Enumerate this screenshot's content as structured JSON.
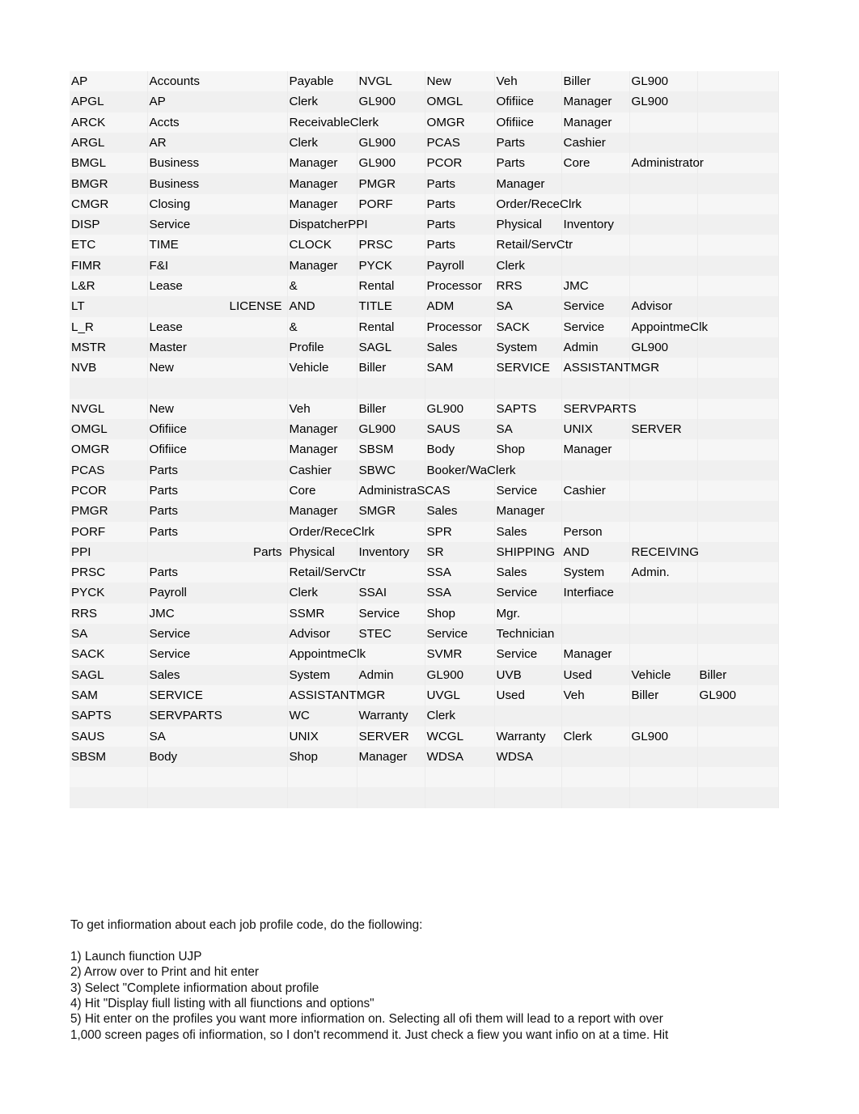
{
  "document": {
    "kind": "job-profile-code-listing",
    "columns": 9
  },
  "table": {
    "rows": [
      {
        "cells": [
          "AP",
          "Accounts",
          "Payable",
          "NVGL",
          "New",
          "Veh",
          "Biller",
          "GL900",
          ""
        ],
        "align2": "left"
      },
      {
        "cells": [
          "APGL",
          "AP",
          "Clerk",
          "GL900",
          "OMGL",
          "Ofifiice",
          "Manager",
          "GL900",
          ""
        ],
        "align2": "left"
      },
      {
        "cells": [
          "ARCK",
          "Accts",
          "ReceivableClerk",
          "",
          "OMGR",
          "Ofifiice",
          "Manager",
          "",
          ""
        ],
        "align2": "left"
      },
      {
        "cells": [
          "ARGL",
          "AR",
          "Clerk",
          "GL900",
          "PCAS",
          "Parts",
          "Cashier",
          "",
          ""
        ],
        "align2": "left"
      },
      {
        "cells": [
          "BMGL",
          "Business",
          "Manager",
          "GL900",
          "PCOR",
          "Parts",
          "Core",
          "Administrator",
          ""
        ],
        "align2": "left"
      },
      {
        "cells": [
          "BMGR",
          "Business",
          "Manager",
          "PMGR",
          "Parts",
          "Manager",
          "",
          "",
          ""
        ],
        "align2": "left"
      },
      {
        "cells": [
          "CMGR",
          "Closing",
          "Manager",
          "PORF",
          "Parts",
          "Order/ReceClrk",
          "",
          "",
          ""
        ],
        "align2": "left"
      },
      {
        "cells": [
          "DISP",
          "Service",
          "DispatcherPPI",
          "",
          "Parts",
          "Physical",
          "Inventory",
          "",
          ""
        ],
        "align2": "left"
      },
      {
        "cells": [
          "ETC",
          "TIME",
          "CLOCK",
          "PRSC",
          "Parts",
          "Retail/ServCtr",
          "",
          "",
          ""
        ],
        "align2": "left"
      },
      {
        "cells": [
          "FIMR",
          "F&I",
          "Manager",
          "PYCK",
          "Payroll",
          "Clerk",
          "",
          "",
          ""
        ],
        "align2": "left"
      },
      {
        "cells": [
          "L&R",
          "Lease",
          "&",
          "Rental",
          "Processor",
          "RRS",
          "JMC",
          "",
          ""
        ],
        "align2": "left"
      },
      {
        "cells": [
          "LT",
          "LICENSE",
          "AND",
          "TITLE",
          "ADM",
          "SA",
          "Service",
          "Advisor",
          ""
        ],
        "align2": "right"
      },
      {
        "cells": [
          "L_R",
          "Lease",
          "&",
          "Rental",
          "Processor",
          "SACK",
          "Service",
          "AppointmeClk",
          ""
        ],
        "align2": "left"
      },
      {
        "cells": [
          "MSTR",
          "Master",
          "Profile",
          "SAGL",
          "Sales",
          "System",
          "Admin",
          "GL900",
          ""
        ],
        "align2": "left"
      },
      {
        "cells": [
          "NVB",
          "New",
          "Vehicle",
          "Biller",
          "SAM",
          "SERVICE",
          "ASSISTANTMGR",
          "",
          ""
        ],
        "align2": "left"
      },
      {
        "cells": [
          "",
          "",
          "",
          "",
          "",
          "",
          "",
          "",
          ""
        ],
        "align2": "left"
      },
      {
        "cells": [
          "NVGL",
          "New",
          "Veh",
          "Biller",
          "GL900",
          "SAPTS",
          "SERVPARTS",
          "",
          ""
        ],
        "align2": "left"
      },
      {
        "cells": [
          "OMGL",
          "Ofifiice",
          "Manager",
          "GL900",
          "SAUS",
          "SA",
          "UNIX",
          "SERVER",
          ""
        ],
        "align2": "left"
      },
      {
        "cells": [
          "OMGR",
          "Ofifiice",
          "Manager",
          "SBSM",
          "Body",
          "Shop",
          "Manager",
          "",
          ""
        ],
        "align2": "left"
      },
      {
        "cells": [
          "PCAS",
          "Parts",
          "Cashier",
          "SBWC",
          "Booker/WaClerk",
          "",
          "",
          "",
          ""
        ],
        "align2": "left"
      },
      {
        "cells": [
          "PCOR",
          "Parts",
          "Core",
          "AdministraSCAS",
          "",
          "Service",
          "Cashier",
          "",
          ""
        ],
        "align2": "left"
      },
      {
        "cells": [
          "PMGR",
          "Parts",
          "Manager",
          "SMGR",
          "Sales",
          "Manager",
          "",
          "",
          ""
        ],
        "align2": "left"
      },
      {
        "cells": [
          "PORF",
          "Parts",
          "Order/ReceClrk",
          "",
          "SPR",
          "Sales",
          "Person",
          "",
          ""
        ],
        "align2": "left"
      },
      {
        "cells": [
          "PPI",
          "Parts",
          "Physical",
          "Inventory",
          "SR",
          "SHIPPING",
          "AND",
          "RECEIVING",
          ""
        ],
        "align2": "right"
      },
      {
        "cells": [
          "PRSC",
          "Parts",
          "Retail/ServCtr",
          "",
          "SSA",
          "Sales",
          "System",
          "Admin.",
          ""
        ],
        "align2": "left"
      },
      {
        "cells": [
          "PYCK",
          "Payroll",
          "Clerk",
          "SSAI",
          "SSA",
          "Service",
          "Interfiace",
          "",
          ""
        ],
        "align2": "left"
      },
      {
        "cells": [
          "RRS",
          "JMC",
          "SSMR",
          "Service",
          "Shop",
          "Mgr.",
          "",
          "",
          ""
        ],
        "align2": "left"
      },
      {
        "cells": [
          "SA",
          "Service",
          "Advisor",
          "STEC",
          "Service",
          "Technician",
          "",
          "",
          ""
        ],
        "align2": "left"
      },
      {
        "cells": [
          "SACK",
          "Service",
          "AppointmeClk",
          "",
          "SVMR",
          "Service",
          "Manager",
          "",
          ""
        ],
        "align2": "left"
      },
      {
        "cells": [
          "SAGL",
          "Sales",
          "System",
          "Admin",
          "GL900",
          "UVB",
          "Used",
          "Vehicle",
          "Biller"
        ],
        "align2": "left"
      },
      {
        "cells": [
          "SAM",
          "SERVICE",
          "ASSISTANTMGR",
          "",
          "UVGL",
          "Used",
          "Veh",
          "Biller",
          "GL900"
        ],
        "align2": "left"
      },
      {
        "cells": [
          "SAPTS",
          "SERVPARTS",
          "WC",
          "Warranty",
          "Clerk",
          "",
          "",
          "",
          ""
        ],
        "align2": "left"
      },
      {
        "cells": [
          "SAUS",
          "SA",
          "UNIX",
          "SERVER",
          "WCGL",
          "Warranty",
          "Clerk",
          "GL900",
          ""
        ],
        "align2": "left"
      },
      {
        "cells": [
          "SBSM",
          "Body",
          "Shop",
          "Manager",
          "WDSA",
          "WDSA",
          "",
          "",
          ""
        ],
        "align2": "left"
      },
      {
        "cells": [
          "",
          "",
          "",
          "",
          "",
          "",
          "",
          "",
          ""
        ],
        "align2": "left"
      },
      {
        "cells": [
          "",
          "",
          "",
          "",
          "",
          "",
          "",
          "",
          ""
        ],
        "align2": "left"
      }
    ]
  },
  "notes": {
    "lead": "To get infiormation about each job profile code, do the fiollowing:",
    "steps": [
      "1) Launch fiunction UJP",
      "2) Arrow over to Print and hit enter",
      "3) Select \"Complete infiormation about profile",
      "4) Hit \"Display fiull listing with all fiunctions and options\""
    ],
    "step5_line1": "5) Hit enter on the profiles you want more infiormation on. Selecting all ofi them will lead to a report with over",
    "step5_line2": "1,000 screen pages ofi infiormation, so I don't recommend it. Just check a fiew you want infio on at a time. Hit"
  }
}
